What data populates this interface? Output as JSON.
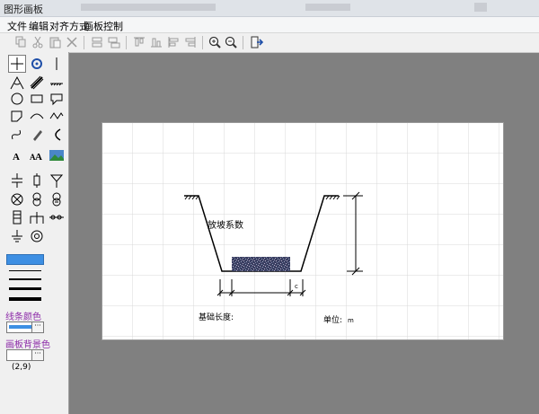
{
  "window": {
    "title": "图形画板"
  },
  "menu": {
    "items": [
      "文件",
      "编辑",
      "对齐方式",
      "画板控制"
    ]
  },
  "toolbar": {
    "icons": [
      "copy-icon",
      "cut-icon",
      "paste-icon",
      "delete-icon",
      "group-icon",
      "ungroup-icon",
      "align-top-icon",
      "align-bottom-icon",
      "align-left-icon",
      "align-right-icon",
      "zoom-in-icon",
      "zoom-out-icon",
      "exit-icon"
    ]
  },
  "left_panel": {
    "line_color_label": "线条颜色",
    "bg_color_label": "画板背景色",
    "coordinates": "(2,9)",
    "more_button": "···",
    "line_color": "#3d8fe3"
  },
  "canvas": {
    "coefficient_label": "放坡系数",
    "base_length_label": "基础长度:",
    "unit_label": "单位:",
    "unit_value": "m",
    "dim_c_label": "c"
  }
}
